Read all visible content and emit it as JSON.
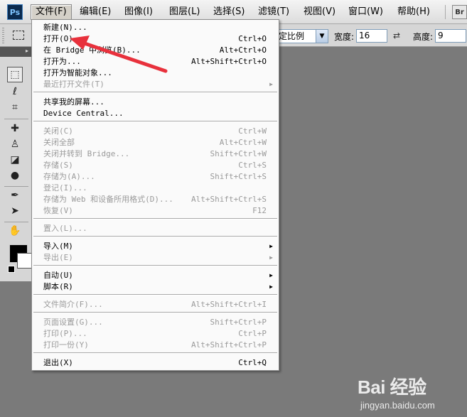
{
  "app": {
    "logo": "Ps",
    "bridge_logo": "Br"
  },
  "menubar": {
    "items": [
      "文件(F)",
      "编辑(E)",
      "图像(I)",
      "图层(L)",
      "选择(S)",
      "滤镜(T)",
      "视图(V)",
      "窗口(W)",
      "帮助(H)"
    ],
    "active_index": 0
  },
  "options_bar": {
    "style_value": "定比例",
    "width_label": "宽度:",
    "width_value": "16",
    "height_label": "高度:",
    "height_value": "9",
    "swap_icon": "swap-icon"
  },
  "file_menu": {
    "items": [
      {
        "label": "新建(N)...",
        "shortcut": "",
        "disabled": false,
        "submenu": false
      },
      {
        "label": "打开(O)...",
        "shortcut": "Ctrl+O",
        "disabled": false,
        "submenu": false
      },
      {
        "label": "在 Bridge 中浏览(B)...",
        "shortcut": "Alt+Ctrl+O",
        "disabled": false,
        "submenu": false
      },
      {
        "label": "打开为...",
        "shortcut": "Alt+Shift+Ctrl+O",
        "disabled": false,
        "submenu": false
      },
      {
        "label": "打开为智能对象...",
        "shortcut": "",
        "disabled": false,
        "submenu": false
      },
      {
        "label": "最近打开文件(T)",
        "shortcut": "",
        "disabled": true,
        "submenu": true
      },
      {
        "label": "共享我的屏幕...",
        "shortcut": "",
        "disabled": false,
        "submenu": false
      },
      {
        "label": "Device Central...",
        "shortcut": "",
        "disabled": false,
        "submenu": false
      },
      {
        "label": "关闭(C)",
        "shortcut": "Ctrl+W",
        "disabled": true,
        "submenu": false
      },
      {
        "label": "关闭全部",
        "shortcut": "Alt+Ctrl+W",
        "disabled": true,
        "submenu": false
      },
      {
        "label": "关闭并转到 Bridge...",
        "shortcut": "Shift+Ctrl+W",
        "disabled": true,
        "submenu": false
      },
      {
        "label": "存储(S)",
        "shortcut": "Ctrl+S",
        "disabled": true,
        "submenu": false
      },
      {
        "label": "存储为(A)...",
        "shortcut": "Shift+Ctrl+S",
        "disabled": true,
        "submenu": false
      },
      {
        "label": "登记(I)...",
        "shortcut": "",
        "disabled": true,
        "submenu": false
      },
      {
        "label": "存储为 Web 和设备所用格式(D)...",
        "shortcut": "Alt+Shift+Ctrl+S",
        "disabled": true,
        "submenu": false
      },
      {
        "label": "恢复(V)",
        "shortcut": "F12",
        "disabled": true,
        "submenu": false
      },
      {
        "label": "置入(L)...",
        "shortcut": "",
        "disabled": true,
        "submenu": false
      },
      {
        "label": "导入(M)",
        "shortcut": "",
        "disabled": false,
        "submenu": true
      },
      {
        "label": "导出(E)",
        "shortcut": "",
        "disabled": true,
        "submenu": true
      },
      {
        "label": "自动(U)",
        "shortcut": "",
        "disabled": false,
        "submenu": true
      },
      {
        "label": "脚本(R)",
        "shortcut": "",
        "disabled": false,
        "submenu": true
      },
      {
        "label": "文件简介(F)...",
        "shortcut": "Alt+Shift+Ctrl+I",
        "disabled": true,
        "submenu": false
      },
      {
        "label": "页面设置(G)...",
        "shortcut": "Shift+Ctrl+P",
        "disabled": true,
        "submenu": false
      },
      {
        "label": "打印(P)...",
        "shortcut": "Ctrl+P",
        "disabled": true,
        "submenu": false
      },
      {
        "label": "打印一份(Y)",
        "shortcut": "Alt+Shift+Ctrl+P",
        "disabled": true,
        "submenu": false
      },
      {
        "label": "退出(X)",
        "shortcut": "Ctrl+Q",
        "disabled": false,
        "submenu": false
      }
    ],
    "submenu_arrow": "▶"
  },
  "tools": [
    {
      "name": "marquee-tool-icon",
      "glyph": "⬚",
      "selected": true
    },
    {
      "name": "lasso-tool-icon",
      "glyph": "ℓ",
      "selected": false
    },
    {
      "name": "crop-tool-icon",
      "glyph": "⌗",
      "selected": false
    },
    {
      "name": "healing-brush-icon",
      "glyph": "✚",
      "selected": false
    },
    {
      "name": "stamp-tool-icon",
      "glyph": "♙",
      "selected": false
    },
    {
      "name": "eraser-tool-icon",
      "glyph": "◪",
      "selected": false
    },
    {
      "name": "blur-tool-icon",
      "glyph": "●",
      "selected": false
    },
    {
      "name": "pen-tool-icon",
      "glyph": "✒",
      "selected": false
    },
    {
      "name": "path-select-tool-icon",
      "glyph": "➤",
      "selected": false
    },
    {
      "name": "hand-tool-icon",
      "glyph": "✋",
      "selected": false
    }
  ],
  "watermark": {
    "brand": "Bai 经验",
    "url": "jingyan.baidu.com"
  },
  "colors": {
    "foreground": "#000000",
    "background": "#ffffff",
    "annotation_arrow": "#e8313c",
    "canvas": "#7a7a7a"
  }
}
